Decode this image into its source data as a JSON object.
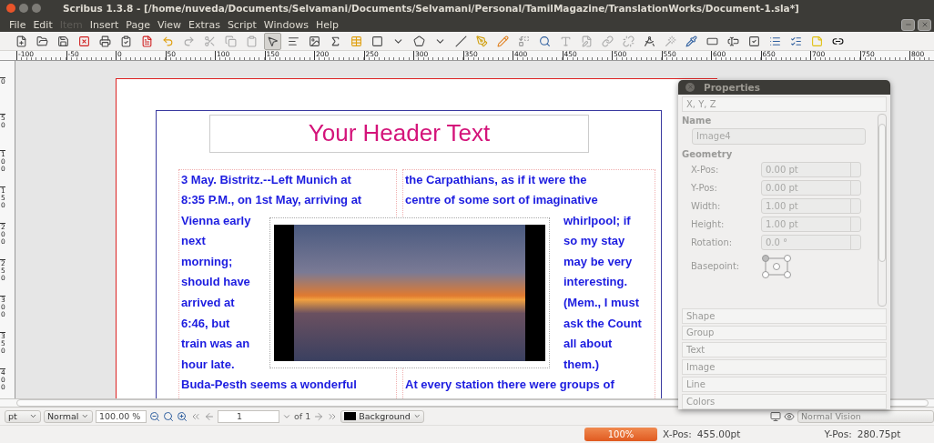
{
  "window": {
    "title": "Scribus 1.3.8 - [/home/nuveda/Documents/Selvamani/Documents/Selvamani/Personal/TamilMagazine/TranslationWorks/Document-1.sla*]"
  },
  "menu": [
    {
      "label": "File",
      "disabled": false
    },
    {
      "label": "Edit",
      "disabled": false
    },
    {
      "label": "Item",
      "disabled": true
    },
    {
      "label": "Insert",
      "disabled": false
    },
    {
      "label": "Page",
      "disabled": false
    },
    {
      "label": "View",
      "disabled": false
    },
    {
      "label": "Extras",
      "disabled": false
    },
    {
      "label": "Script",
      "disabled": false
    },
    {
      "label": "Windows",
      "disabled": false
    },
    {
      "label": "Help",
      "disabled": false
    }
  ],
  "ruler": {
    "horizontal": [
      "-100",
      "-50",
      "0",
      "50",
      "100",
      "150",
      "200",
      "250",
      "300",
      "350",
      "400",
      "450",
      "500",
      "550",
      "600",
      "650",
      "700",
      "750",
      "800"
    ],
    "vertical": [
      "0",
      "50",
      "100",
      "150",
      "200",
      "250",
      "300",
      "350",
      "400"
    ]
  },
  "document": {
    "header": "Your Header Text",
    "columns": [
      {
        "lines": [
          "3 May. Bistritz.--Left Munich at",
          "8:35 P.M., on 1st May, arriving at",
          "Vienna early",
          "next",
          "morning;",
          "should have",
          "arrived at",
          "6:46, but",
          "train was an",
          "hour late.",
          "Buda-Pesth seems a wonderful"
        ]
      },
      {
        "lines": [
          "the Carpathians, as if it were the",
          "centre of some sort of imaginative",
          "whirlpool; if",
          "so my stay",
          "may be very",
          "interesting.",
          "(Mem., I must",
          "ask the Count",
          "all about",
          "them.)",
          "At every station there were groups of"
        ]
      }
    ]
  },
  "properties": {
    "title": "Properties",
    "top_section": "X, Y, Z",
    "name_label": "Name",
    "name_value": "Image4",
    "geometry_label": "Geometry",
    "fields": [
      {
        "label": "X-Pos:",
        "value": "0.00 pt"
      },
      {
        "label": "Y-Pos:",
        "value": "0.00 pt"
      },
      {
        "label": "Width:",
        "value": "1.00 pt"
      },
      {
        "label": "Height:",
        "value": "1.00 pt"
      },
      {
        "label": "Rotation:",
        "value": "0.0 °"
      }
    ],
    "basepoint_label": "Basepoint:",
    "sections": [
      "Shape",
      "Group",
      "Text",
      "Image",
      "Line",
      "Colors"
    ]
  },
  "bottom_bar": {
    "unit": "pt",
    "mode": "Normal",
    "zoom": "100.00 %",
    "page": "1",
    "page_count": "of 1",
    "layer": {
      "name": "Background",
      "color": "#000000"
    },
    "vision": {
      "value": "Normal Vision",
      "disabled": true
    }
  },
  "status_bar": {
    "progress": {
      "label": "100%",
      "level": 1
    },
    "x_label": "X-Pos:",
    "x_value": "455.00pt",
    "y_label": "Y-Pos:",
    "y_value": "280.75pt"
  }
}
